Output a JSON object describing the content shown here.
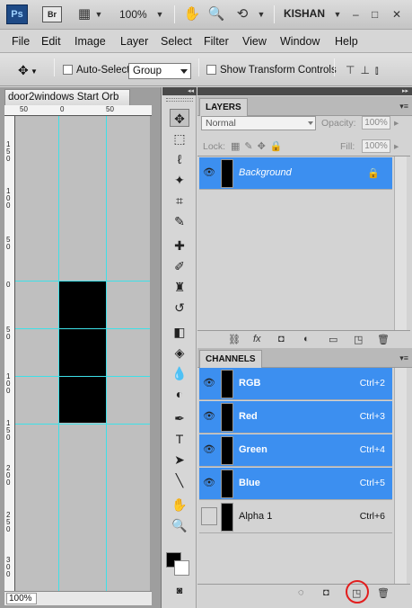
{
  "app": {
    "logo": "Ps",
    "bridge_label": "Br",
    "zoom": "100%",
    "workspace": "KISHAN",
    "window_buttons": [
      "–",
      "□",
      "✕"
    ]
  },
  "menu": [
    "File",
    "Edit",
    "Image",
    "Layer",
    "Select",
    "Filter",
    "View",
    "Window",
    "Help"
  ],
  "options": {
    "auto_select_label": "Auto-Select:",
    "auto_select_checked": false,
    "auto_select_value": "Group",
    "show_transform_label": "Show Transform Controls",
    "show_transform_checked": false
  },
  "document": {
    "tab_title": "door2windows Start Orb",
    "ruler_h_ticks": [
      "50",
      "0",
      "50"
    ],
    "ruler_v_ticks": [
      "150",
      "100",
      "50",
      "0",
      "50",
      "100",
      "150",
      "200",
      "250",
      "300"
    ],
    "zoom": "100%"
  },
  "tools": [
    {
      "name": "move-tool-icon",
      "glyph": "✥"
    },
    {
      "name": "marquee-tool-icon",
      "glyph": "⬚"
    },
    {
      "name": "lasso-tool-icon",
      "glyph": "ℓ"
    },
    {
      "name": "magic-wand-tool-icon",
      "glyph": "✦"
    },
    {
      "name": "crop-tool-icon",
      "glyph": "⌗"
    },
    {
      "name": "eyedropper-tool-icon",
      "glyph": "✎"
    },
    {
      "name": "spot-healing-tool-icon",
      "glyph": "✚"
    },
    {
      "name": "brush-tool-icon",
      "glyph": "✐"
    },
    {
      "name": "clone-stamp-tool-icon",
      "glyph": "♜"
    },
    {
      "name": "history-brush-tool-icon",
      "glyph": "↺"
    },
    {
      "name": "eraser-tool-icon",
      "glyph": "◧"
    },
    {
      "name": "paint-bucket-tool-icon",
      "glyph": "◈"
    },
    {
      "name": "blur-tool-icon",
      "glyph": "💧"
    },
    {
      "name": "dodge-tool-icon",
      "glyph": "◐"
    },
    {
      "name": "pen-tool-icon",
      "glyph": "✒"
    },
    {
      "name": "type-tool-icon",
      "glyph": "T"
    },
    {
      "name": "path-selection-tool-icon",
      "glyph": "➤"
    },
    {
      "name": "line-tool-icon",
      "glyph": "╲"
    },
    {
      "name": "hand-tool-icon",
      "glyph": "✋"
    },
    {
      "name": "zoom-tool-icon",
      "glyph": "🔍"
    }
  ],
  "layers_panel": {
    "tab": "LAYERS",
    "blend_mode": "Normal",
    "opacity_label": "Opacity:",
    "opacity_value": "100%",
    "lock_label": "Lock:",
    "fill_label": "Fill:",
    "fill_value": "100%",
    "layers": [
      {
        "name": "Background",
        "visible": true,
        "selected": true,
        "locked": true
      }
    ]
  },
  "channels_panel": {
    "tab": "CHANNELS",
    "channels": [
      {
        "name": "RGB",
        "shortcut": "Ctrl+2",
        "visible": true,
        "selected": true
      },
      {
        "name": "Red",
        "shortcut": "Ctrl+3",
        "visible": true,
        "selected": true
      },
      {
        "name": "Green",
        "shortcut": "Ctrl+4",
        "visible": true,
        "selected": true
      },
      {
        "name": "Blue",
        "shortcut": "Ctrl+5",
        "visible": true,
        "selected": true
      },
      {
        "name": "Alpha 1",
        "shortcut": "Ctrl+6",
        "visible": false,
        "selected": false
      }
    ]
  },
  "colors": {
    "selection_blue": "#3c8ff0",
    "guide_cyan": "#3ee0e8",
    "highlight_red": "#e21e1e"
  }
}
